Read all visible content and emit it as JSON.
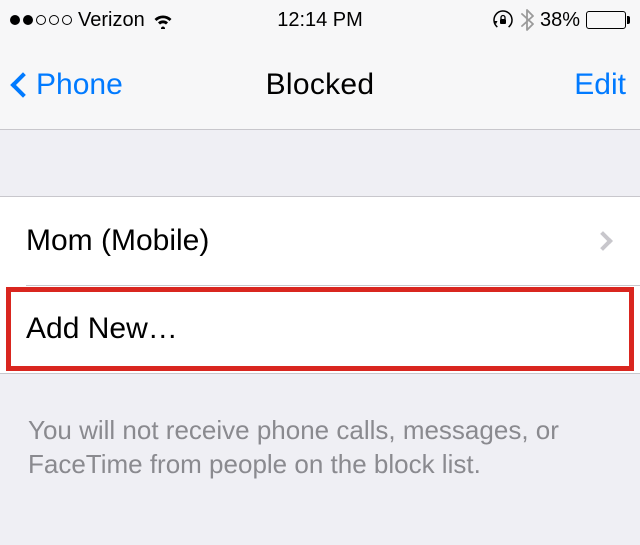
{
  "status": {
    "carrier": "Verizon",
    "time": "12:14 PM",
    "battery_pct": "38%",
    "battery_level": 38
  },
  "nav": {
    "back_label": "Phone",
    "title": "Blocked",
    "edit_label": "Edit"
  },
  "list": {
    "items": [
      {
        "label": "Mom (Mobile)"
      },
      {
        "label": "Add New…"
      }
    ]
  },
  "footer": {
    "text": "You will not receive phone calls, messages, or FaceTime from people on the block list."
  }
}
